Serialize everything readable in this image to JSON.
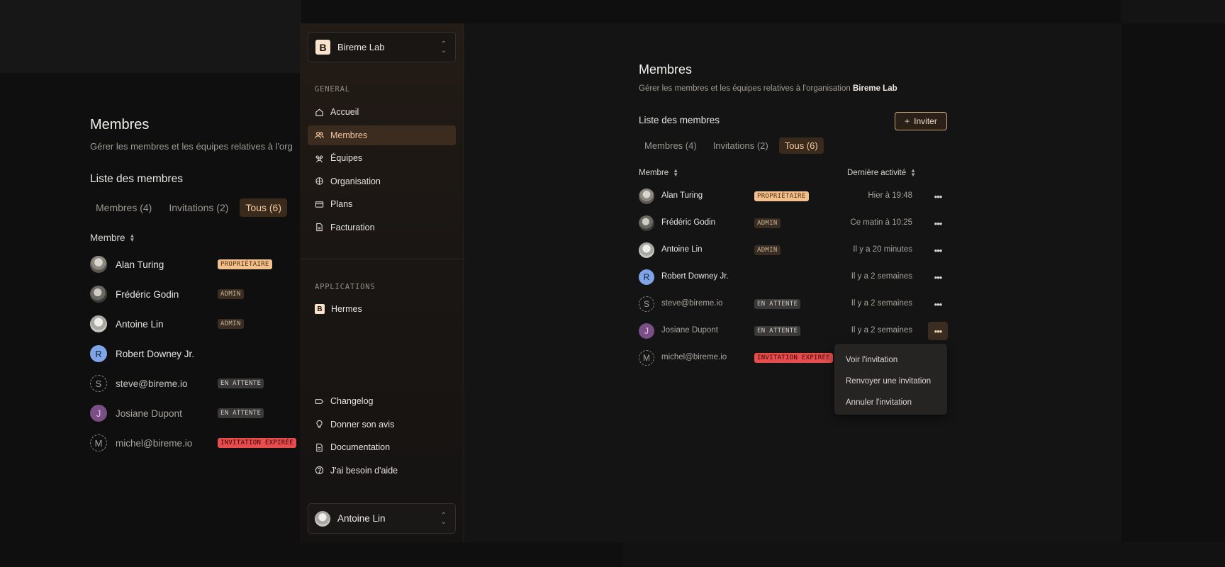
{
  "ghost": {
    "title": "Membres",
    "subtitle": "Gérer les membres et les équipes relatives à l'org",
    "list_title": "Liste des membres",
    "tabs": [
      {
        "label": "Membres (4)",
        "active": false
      },
      {
        "label": "Invitations (2)",
        "active": false
      },
      {
        "label": "Tous (6)",
        "active": true
      }
    ],
    "col_member": "Membre"
  },
  "sidebar": {
    "org_name": "Bireme Lab",
    "org_initial": "B",
    "general_label": "GENERAL",
    "nav": [
      {
        "label": "Accueil",
        "icon": "home-icon"
      },
      {
        "label": "Membres",
        "icon": "users-icon",
        "active": true
      },
      {
        "label": "Équipes",
        "icon": "teams-icon"
      },
      {
        "label": "Organisation",
        "icon": "organisation-icon"
      },
      {
        "label": "Plans",
        "icon": "card-icon"
      },
      {
        "label": "Facturation",
        "icon": "invoice-icon"
      }
    ],
    "applications_label": "APPLICATIONS",
    "apps": [
      {
        "label": "Hermes",
        "initial": "B"
      }
    ],
    "footer_nav": [
      {
        "label": "Changelog",
        "icon": "tag-icon"
      },
      {
        "label": "Donner son avis",
        "icon": "lightbulb-icon"
      },
      {
        "label": "Documentation",
        "icon": "document-icon"
      },
      {
        "label": "J'ai besoin d'aide",
        "icon": "help-icon"
      }
    ],
    "user_name": "Antoine Lin"
  },
  "main": {
    "title": "Membres",
    "subtitle_prefix": "Gérer les membres et les équipes relatives à l'organisation",
    "subtitle_org": "Bireme Lab",
    "list_title": "Liste des membres",
    "invite_label": "Inviter",
    "tabs": [
      {
        "label": "Membres (4)",
        "active": false
      },
      {
        "label": "Invitations (2)",
        "active": false
      },
      {
        "label": "Tous (6)",
        "active": true
      }
    ],
    "col_member": "Membre",
    "col_activity": "Dernière activité",
    "members": [
      {
        "name": "Alan Turing",
        "avatar": "photo",
        "badge": "PROPRIÉTAIRE",
        "badge_type": "owner",
        "activity": "Hier à 19:48"
      },
      {
        "name": "Frédéric Godin",
        "avatar": "photo",
        "badge": "ADMIN",
        "badge_type": "admin",
        "activity": "Ce matin à 10:25"
      },
      {
        "name": "Antoine Lin",
        "avatar": "photo",
        "badge": "ADMIN",
        "badge_type": "admin",
        "activity": "Il y a 20 minutes"
      },
      {
        "name": "Robert Downey Jr.",
        "avatar": "R",
        "badge": "",
        "badge_type": "",
        "activity": "Il y a 2 semaines"
      },
      {
        "name": "steve@bireme.io",
        "avatar": "S",
        "badge": "EN ATTENTE",
        "badge_type": "pending",
        "activity": "Il y a 2 semaines"
      },
      {
        "name": "Josiane Dupont",
        "avatar": "J",
        "badge": "EN ATTENTE",
        "badge_type": "pending",
        "activity": "Il y a 2 semaines"
      },
      {
        "name": "michel@bireme.io",
        "avatar": "M",
        "badge": "INVITATION EXPIRÉE",
        "badge_type": "expired",
        "activity": ""
      }
    ],
    "context_menu": [
      "Voir l'invitation",
      "Renvoyer une invitation",
      "Annuler l'invitation"
    ]
  },
  "colors": {
    "accent": "#f3c79f",
    "accent_bg": "#3c2c20",
    "owner_badge": "#f0c08e",
    "expired_badge": "#e84c4c",
    "background": "#0f0f0f"
  }
}
